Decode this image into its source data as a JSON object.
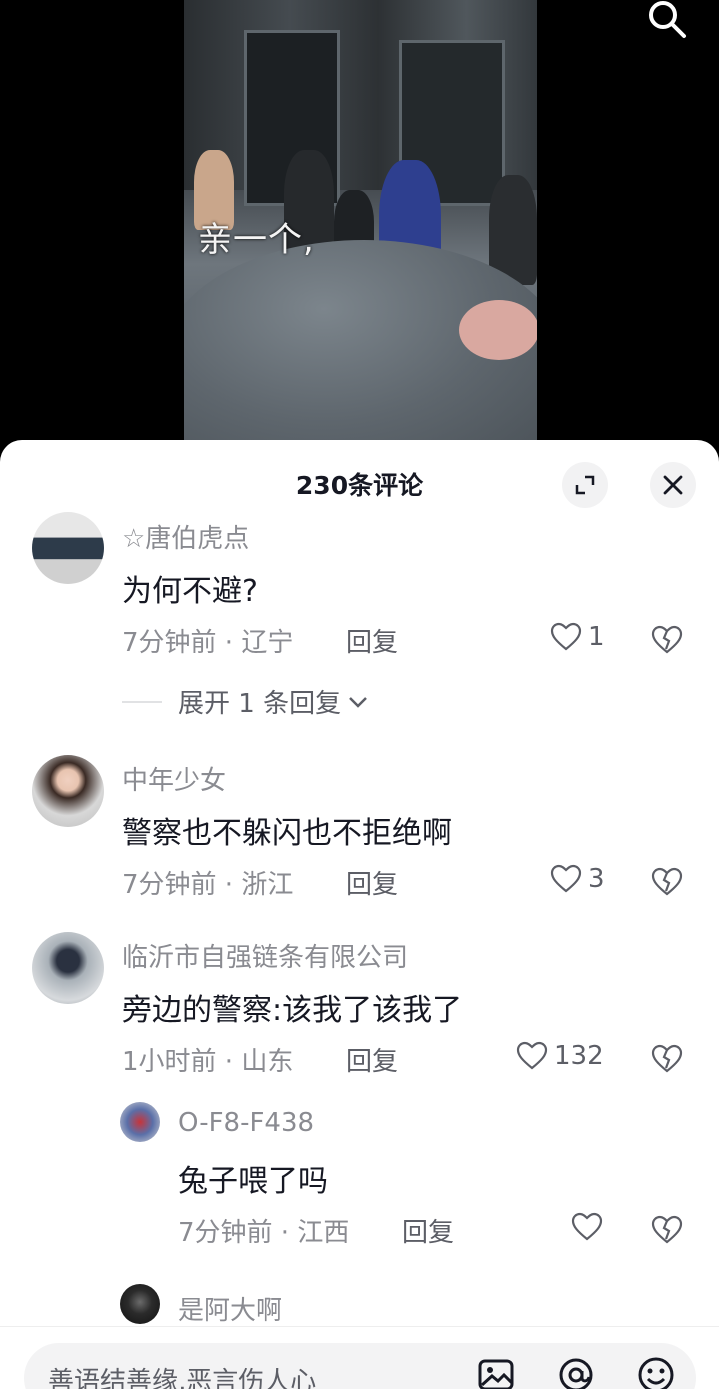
{
  "video": {
    "caption": "亲一个,"
  },
  "comments_header": {
    "title": "230条评论"
  },
  "comments": [
    {
      "name": "☆唐伯虎点",
      "text": "为何不避?",
      "time": "7分钟前",
      "region": "辽宁",
      "reply": "回复",
      "likes": "1",
      "expand": "展开 1 条回复"
    },
    {
      "name": "中年少女",
      "text": "警察也不躲闪也不拒绝啊",
      "time": "7分钟前",
      "region": "浙江",
      "reply": "回复",
      "likes": "3"
    },
    {
      "name": "临沂市自强链条有限公司",
      "text": "旁边的警察:该我了该我了",
      "time": "1小时前",
      "region": "山东",
      "reply": "回复",
      "likes": "132",
      "replies": [
        {
          "name": "O-F8-F438",
          "text": "兔子喂了吗",
          "time": "7分钟前",
          "region": "江西",
          "reply": "回复",
          "likes": ""
        }
      ]
    },
    {
      "name": "是阿大啊"
    }
  ],
  "input": {
    "placeholder": "善语结善缘,恶言伤人心"
  },
  "colors": {
    "sheet_bg": "#ffffff",
    "primary_text": "#161823",
    "secondary_text": "#8a8b91"
  }
}
